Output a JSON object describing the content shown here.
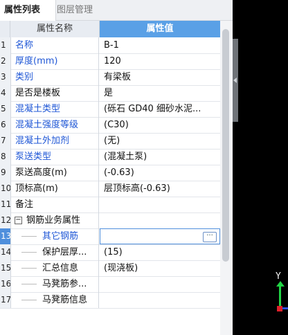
{
  "tabs": [
    "属性列表",
    "图层管理"
  ],
  "columns": {
    "name": "属性名称",
    "value": "属性值"
  },
  "rows": [
    {
      "n": "1",
      "name": "名称",
      "value": "B-1"
    },
    {
      "n": "2",
      "name": "厚度(mm)",
      "value": "120"
    },
    {
      "n": "3",
      "name": "类别",
      "value": "有梁板"
    },
    {
      "n": "4",
      "name": "是否是楼板",
      "value": "是"
    },
    {
      "n": "5",
      "name": "混凝土类型",
      "value": "(砾石 GD40 细砂水泥..."
    },
    {
      "n": "6",
      "name": "混凝土强度等级",
      "value": "(C30)"
    },
    {
      "n": "7",
      "name": "混凝土外加剂",
      "value": "(无)"
    },
    {
      "n": "8",
      "name": "泵送类型",
      "value": "(混凝土泵)"
    },
    {
      "n": "9",
      "name": "泵送高度(m)",
      "value": "(-0.63)"
    },
    {
      "n": "10",
      "name": "顶标高(m)",
      "value": "层顶标高(-0.63)"
    },
    {
      "n": "11",
      "name": "备注",
      "value": ""
    },
    {
      "n": "12",
      "name": "钢筋业务属性",
      "value": ""
    },
    {
      "n": "13",
      "name": "其它钢筋",
      "value": ""
    },
    {
      "n": "14",
      "name": "保护层厚...",
      "value": "(15)"
    },
    {
      "n": "15",
      "name": "汇总信息",
      "value": "(现浇板)"
    },
    {
      "n": "16",
      "name": "马凳筋参...",
      "value": ""
    },
    {
      "n": "17",
      "name": "马凳筋信息",
      "value": ""
    }
  ],
  "group_toggle": "−",
  "ellipsis_button": "···",
  "axis_label": "Y",
  "colors": {
    "accent": "#5aa0e6",
    "link": "#1f57d6",
    "selected": "#4f8fdc"
  }
}
